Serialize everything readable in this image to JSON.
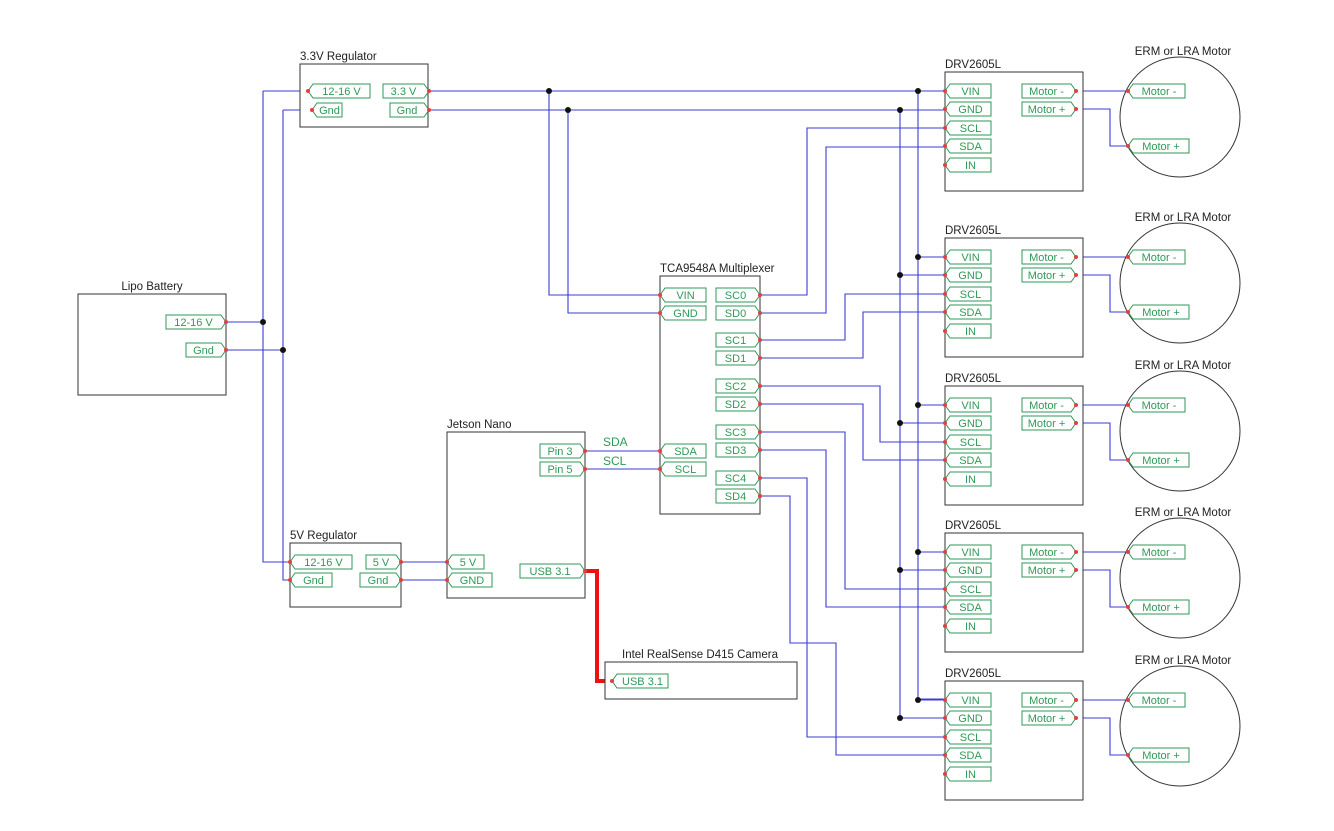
{
  "labels": {
    "reg33": "3.3V Regulator",
    "battery": "Lipo Battery",
    "reg5": "5V Regulator",
    "jetson": "Jetson Nano",
    "mux": "TCA9548A Multiplexer",
    "camera": "Intel RealSense D415 Camera",
    "drv": "DRV2605L",
    "motor": "ERM or LRA Motor"
  },
  "pins": {
    "v1216": "12-16 V",
    "gnd_mixed": "Gnd",
    "v33": "3.3 V",
    "v5": "5 V",
    "GND": "GND",
    "VIN": "VIN",
    "SDA": "SDA",
    "SCL": "SCL",
    "pin3": "Pin 3",
    "pin5": "Pin 5",
    "usb": "USB 3.1",
    "IN": "IN",
    "motor_minus": "Motor -",
    "motor_plus": "Motor +",
    "mux_channels": [
      "SC0",
      "SD0",
      "SC1",
      "SD1",
      "SC2",
      "SD2",
      "SC3",
      "SD3",
      "SC4",
      "SD4"
    ]
  },
  "wire_labels": {
    "sda": "SDA",
    "scl": "SCL"
  },
  "colors": {
    "wire": "#3b3bd6",
    "usb_wire": "#ee1111",
    "pin": "#2e9a57",
    "box": "#333333"
  }
}
